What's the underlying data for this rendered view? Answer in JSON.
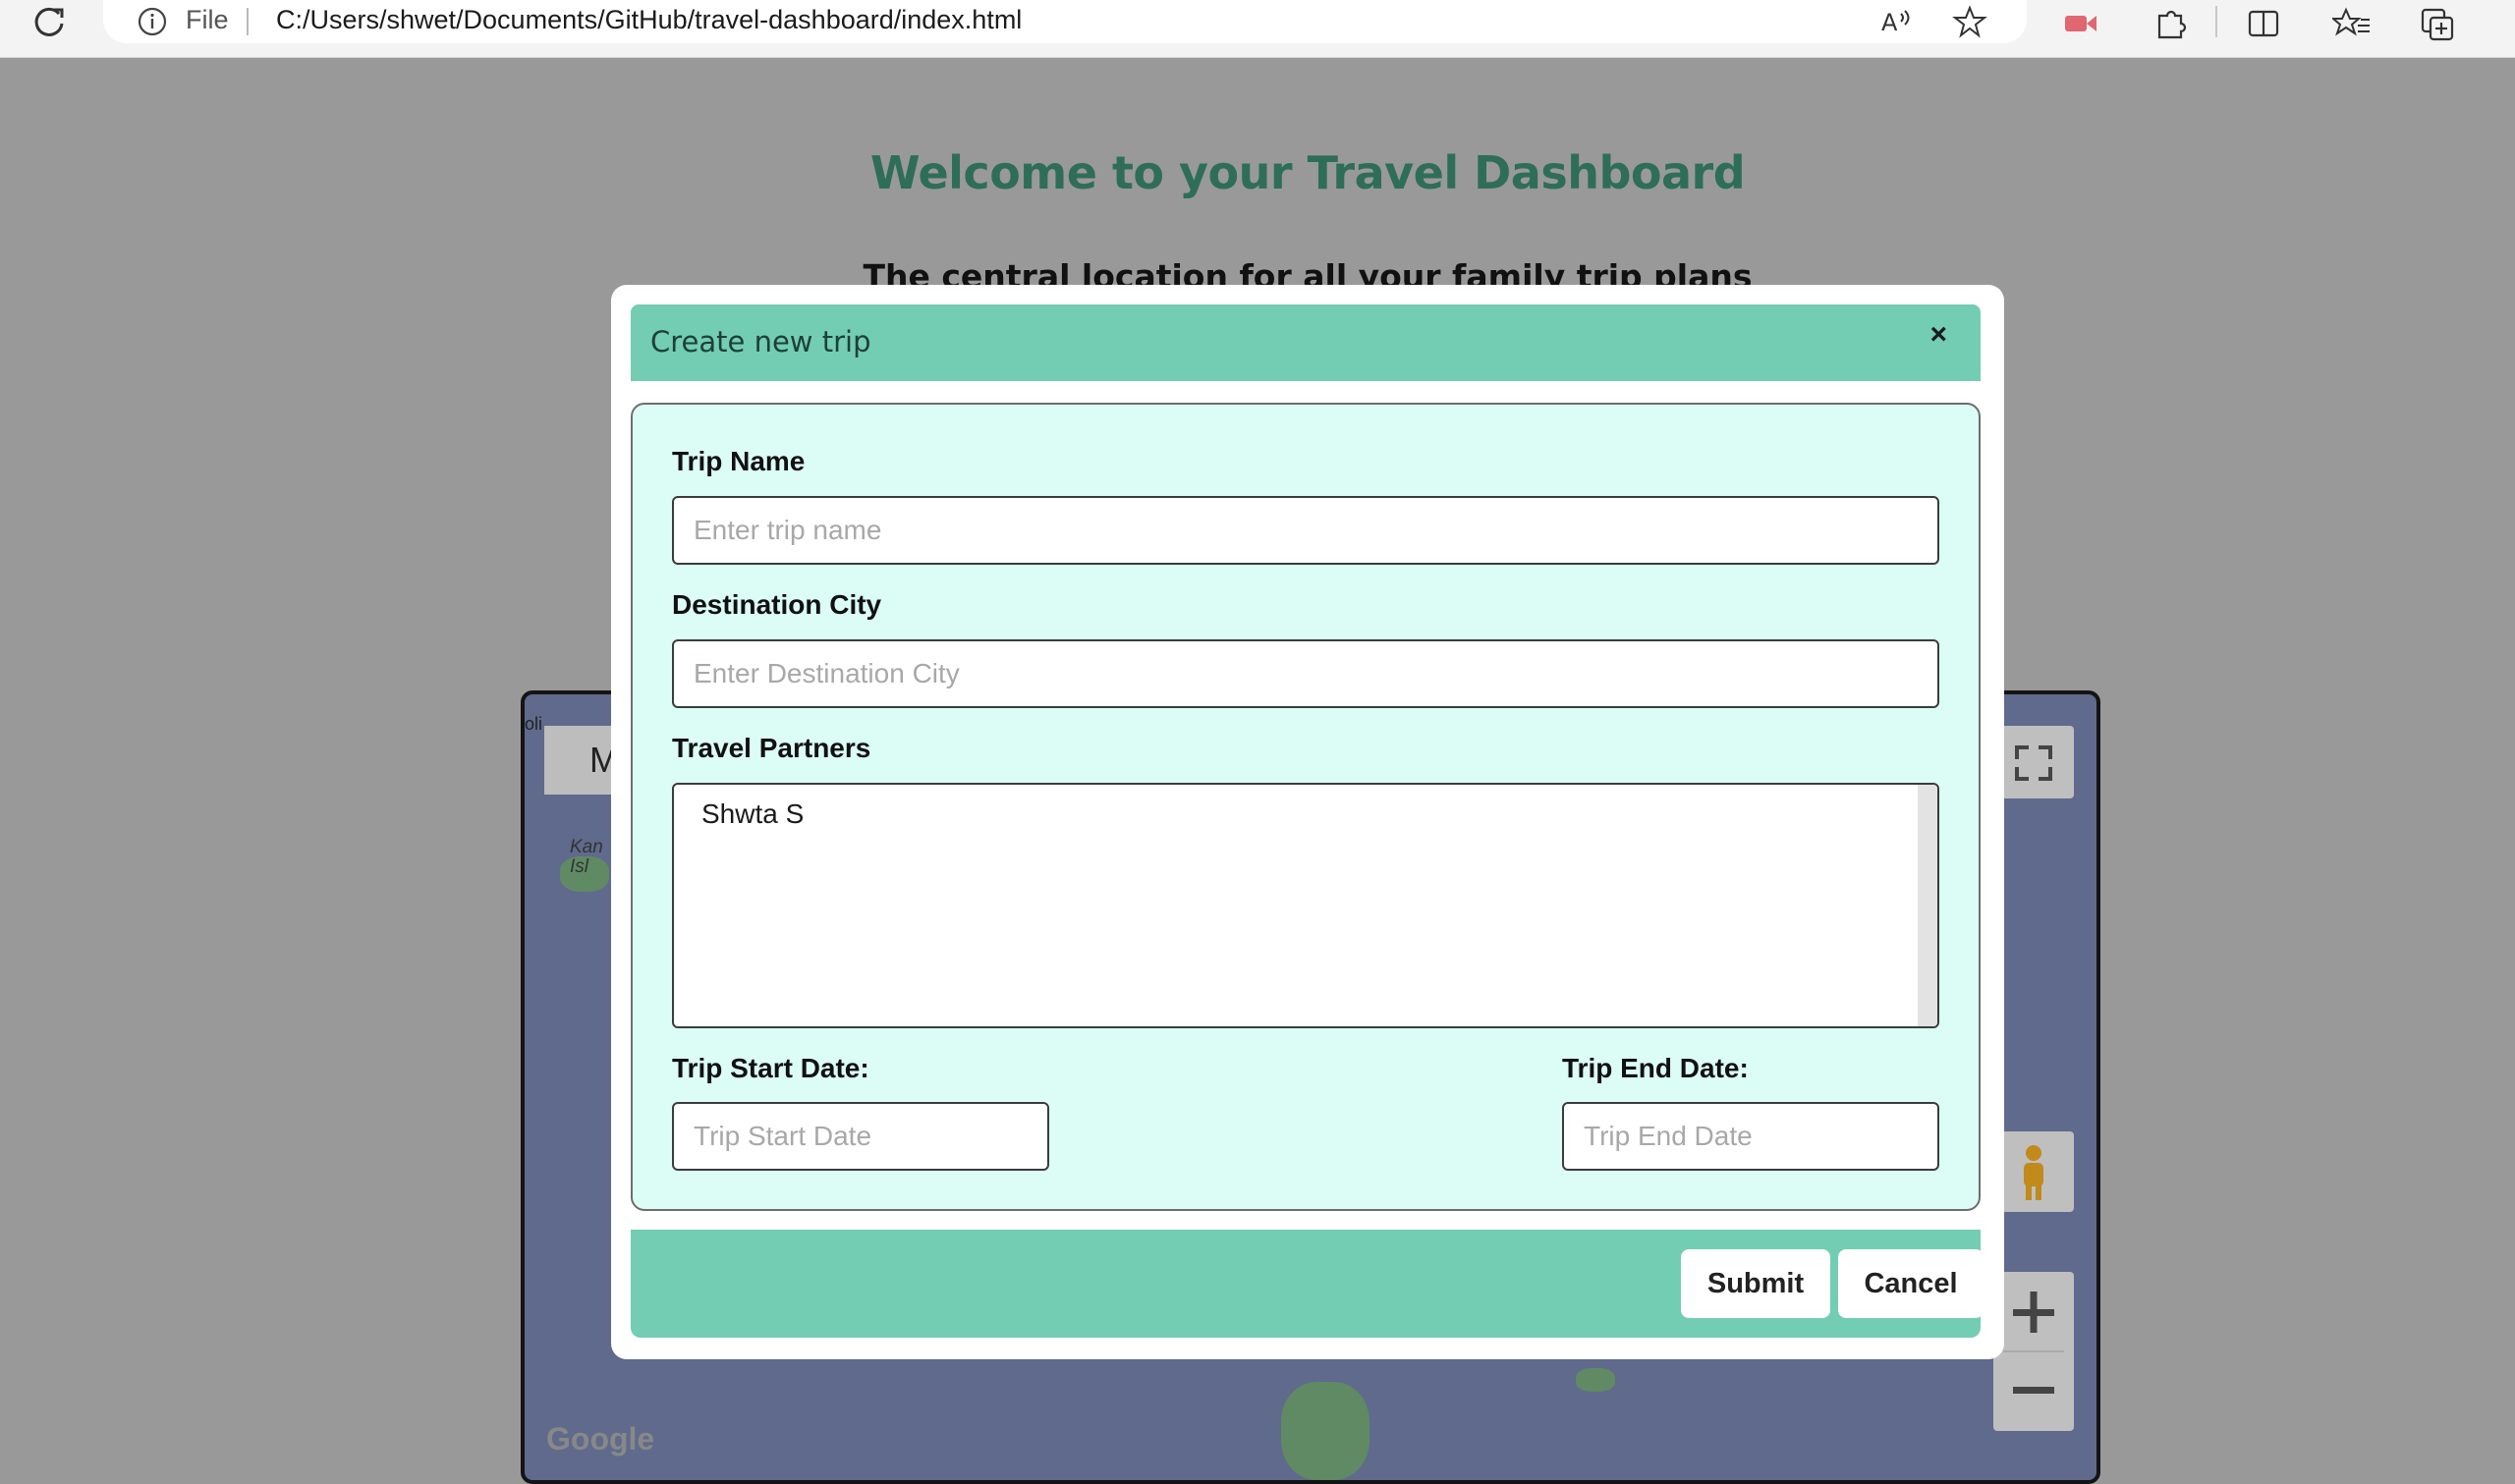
{
  "browser": {
    "scheme_label": "File",
    "url": "C:/Users/shwet/Documents/GitHub/travel-dashboard/index.html",
    "icons": [
      "reload-icon",
      "info-icon",
      "read-aloud-icon",
      "favorite-star-icon",
      "video-extension-icon",
      "extensions-icon",
      "split-screen-icon",
      "favorites-icon",
      "collections-icon"
    ]
  },
  "page": {
    "title": "Welcome to your Travel Dashboard",
    "subtitle": "The central location for all your family trip plans"
  },
  "map": {
    "map_type_label": "M",
    "corner_label": "oli",
    "place_label": "Kan\nIsl",
    "google_label": "Google"
  },
  "modal": {
    "title": "Create new trip",
    "close_label": "×",
    "trip_name": {
      "label": "Trip Name",
      "placeholder": "Enter trip name",
      "value": ""
    },
    "destination": {
      "label": "Destination City",
      "placeholder": "Enter Destination City",
      "value": ""
    },
    "partners": {
      "label": "Travel Partners",
      "options": [
        "Shwta S"
      ]
    },
    "start_date": {
      "label": "Trip Start Date:",
      "placeholder": "Trip Start Date",
      "value": ""
    },
    "end_date": {
      "label": "Trip End Date:",
      "placeholder": "Trip End Date",
      "value": ""
    },
    "submit_label": "Submit",
    "cancel_label": "Cancel"
  },
  "colors": {
    "accent": "#72cdb3",
    "modal_body_bg": "#dbfdf5",
    "title_green": "#2e6e58",
    "overlay": "#999999"
  }
}
